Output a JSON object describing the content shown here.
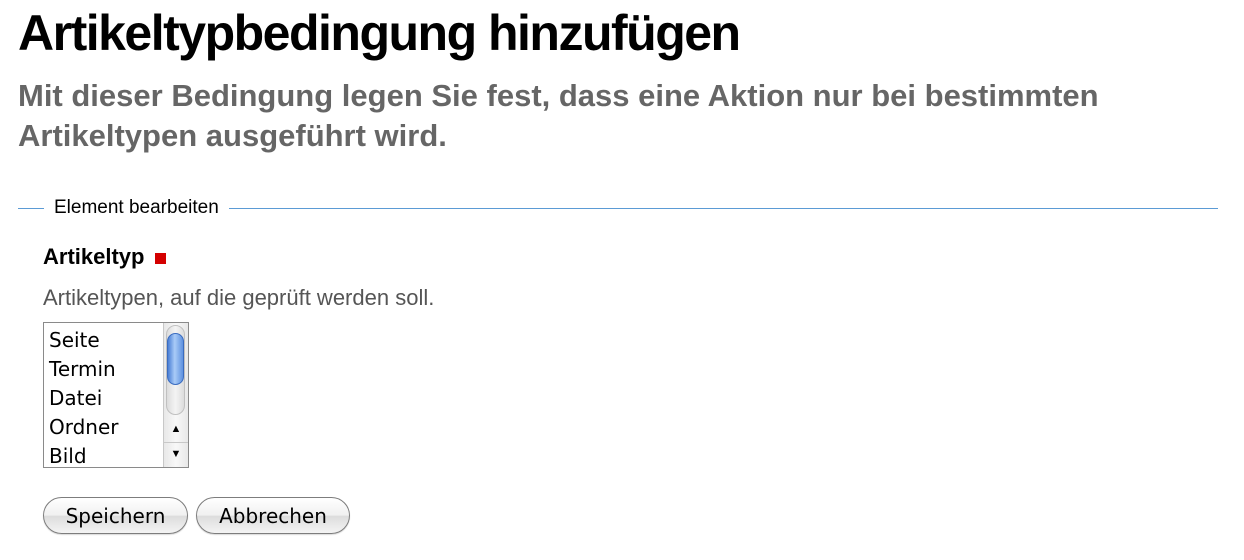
{
  "page": {
    "title": "Artikeltypbedingung hinzufügen",
    "subtitle": "Mit dieser Bedingung legen Sie fest, dass eine Aktion nur bei bestimmten Artikeltypen ausgeführt wird."
  },
  "fieldset": {
    "legend": "Element bearbeiten"
  },
  "field": {
    "label": "Artikeltyp",
    "required": true,
    "help": "Artikeltypen, auf die geprüft werden soll.",
    "options": [
      "Seite",
      "Termin",
      "Datei",
      "Ordner",
      "Bild"
    ]
  },
  "buttons": {
    "save": "Speichern",
    "cancel": "Abbrechen"
  },
  "icons": {
    "required": "required-marker-square",
    "scroll_up": "scroll-up-arrow-icon",
    "scroll_down": "scroll-down-arrow-icon"
  },
  "colors": {
    "legend_line": "#5b9bd5",
    "required_mark": "#d40000",
    "subtitle": "#666666"
  }
}
